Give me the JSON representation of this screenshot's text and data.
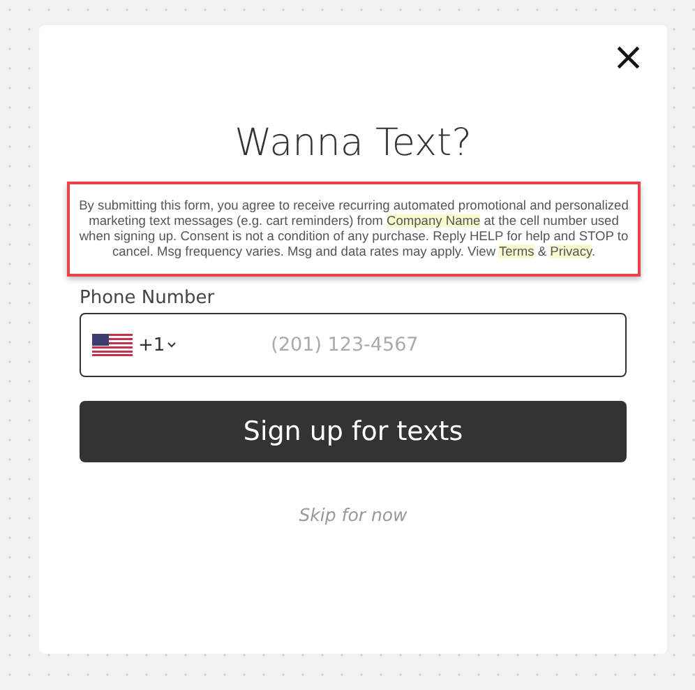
{
  "modal": {
    "close_label": "×",
    "title": "Wanna Text?",
    "disclaimer": {
      "outlined": true,
      "segments": [
        {
          "text": "By submitting this form, you agree to receive recurring automated promotional and personalized marketing text messages (e.g. cart reminders) from ",
          "highlighted": false
        },
        {
          "text": "Company Name",
          "highlighted": true
        },
        {
          "text": " at the cell number used when signing up. Consent is not a condition of any purchase. Reply HELP for help and STOP to cancel. Msg frequency varies. Msg and data rates may apply. View ",
          "highlighted": false
        },
        {
          "text": "Terms",
          "highlighted": true
        },
        {
          "text": " & ",
          "highlighted": false
        },
        {
          "text": "Privacy",
          "highlighted": true
        },
        {
          "text": ".",
          "highlighted": false
        }
      ]
    },
    "phone": {
      "label": "Phone Number",
      "country_code": "+1",
      "placeholder": "(201) 123-4567"
    },
    "submit": "Sign up for texts",
    "skip": "Skip for now"
  }
}
